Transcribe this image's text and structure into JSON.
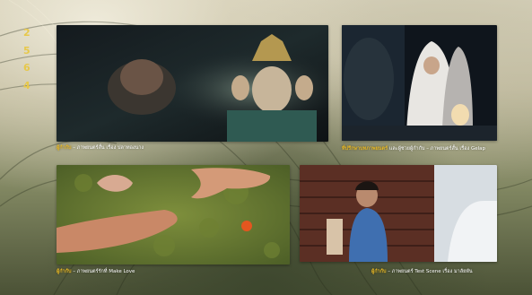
{
  "sidebar": {
    "years": [
      "2",
      "5",
      "6",
      "4"
    ]
  },
  "films": [
    {
      "role": "ผู้กำกับ",
      "description": " – ภาพยนตร์สั้น เรื่อง ปลาทองนาง"
    },
    {
      "role": "ที่ปรึกษาบทภาพยนตร์",
      "description": " และผู้ช่วยผู้กำกับ – ภาพยนตร์สั้น เรื่อง Gelap"
    },
    {
      "role": "ผู้กำกับ",
      "description": " – ภาพยนตร์รักที่ Make Love"
    },
    {
      "role": "ผู้กำกับ",
      "description": " – ภาพยนตร์ Test Scene เรื่อง มาลัยพัน"
    }
  ],
  "colors": {
    "accent": "#e6b726",
    "year_text": "#e7c84a",
    "caption_text": "#ffffff"
  }
}
